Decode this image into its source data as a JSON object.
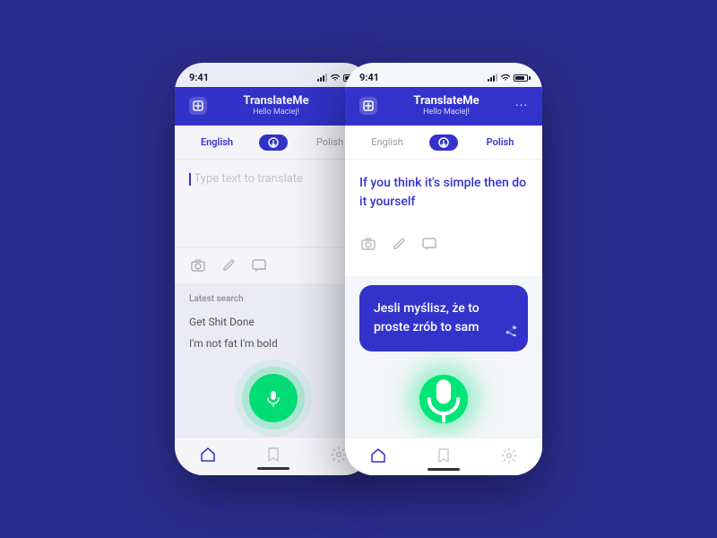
{
  "background_color": "#2b2d8e",
  "phone_back": {
    "status_bar": {
      "time": "9:41"
    },
    "header": {
      "title": "TranslateMe",
      "subtitle": "Hello Maciej!",
      "more_label": "···"
    },
    "tabs": {
      "english": "English",
      "polish": "Polish"
    },
    "input": {
      "placeholder": "Type text to translate"
    },
    "latest_search": {
      "label": "Latest search",
      "items": [
        {
          "text": "Get Shit Done",
          "starred": false
        },
        {
          "text": "I'm not fat I'm bold",
          "starred": true
        }
      ]
    },
    "nav": {
      "items": [
        "home",
        "bookmark",
        "settings"
      ]
    }
  },
  "phone_front": {
    "status_bar": {
      "time": "9:41"
    },
    "header": {
      "title": "TranslateMe",
      "subtitle": "Hello Maciej!",
      "more_label": "···"
    },
    "tabs": {
      "english": "English",
      "polish": "Polish"
    },
    "source_text": "If you think it's simple\nthen do it yourself",
    "result_text": "Jesli myślisz, że to proste\nzrób to sam",
    "nav": {
      "items": [
        "home",
        "bookmark",
        "settings"
      ]
    }
  }
}
